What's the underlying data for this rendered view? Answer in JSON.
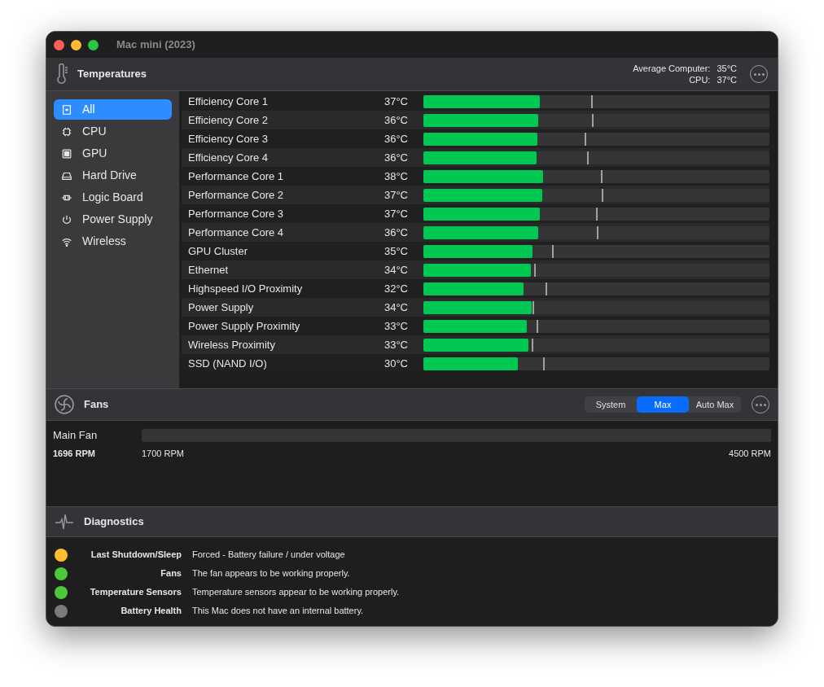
{
  "window": {
    "title": "Mac mini (2023)"
  },
  "temperatures": {
    "title": "Temperatures",
    "summary": [
      {
        "label": "Average Computer:",
        "value": "35°C"
      },
      {
        "label": "CPU:",
        "value": "37°C"
      }
    ]
  },
  "sidebar": {
    "items": [
      {
        "label": "All",
        "kind": "all",
        "selected": true
      },
      {
        "label": "CPU",
        "kind": "cpu",
        "selected": false
      },
      {
        "label": "GPU",
        "kind": "gpu",
        "selected": false
      },
      {
        "label": "Hard Drive",
        "kind": "drive",
        "selected": false
      },
      {
        "label": "Logic Board",
        "kind": "board",
        "selected": false
      },
      {
        "label": "Power Supply",
        "kind": "power",
        "selected": false
      },
      {
        "label": "Wireless",
        "kind": "wireless",
        "selected": false
      }
    ]
  },
  "sensors": [
    {
      "name": "Efficiency Core 1",
      "reading": "37°C",
      "level": 0.336,
      "max": {
        "level": 0.484
      }
    },
    {
      "name": "Efficiency Core 2",
      "reading": "36°C",
      "level": 0.331,
      "max": {
        "level": 0.486
      }
    },
    {
      "name": "Efficiency Core 3",
      "reading": "36°C",
      "level": 0.329,
      "max": {
        "level": 0.465
      }
    },
    {
      "name": "Efficiency Core 4",
      "reading": "36°C",
      "level": 0.326,
      "max": {
        "level": 0.472
      }
    },
    {
      "name": "Performance Core 1",
      "reading": "38°C",
      "level": 0.345,
      "max": {
        "level": 0.512
      }
    },
    {
      "name": "Performance Core 2",
      "reading": "37°C",
      "level": 0.343,
      "max": {
        "level": 0.516
      }
    },
    {
      "name": "Performance Core 3",
      "reading": "37°C",
      "level": 0.336,
      "max": {
        "level": 0.498
      }
    },
    {
      "name": "Performance Core 4",
      "reading": "36°C",
      "level": 0.331,
      "max": {
        "level": 0.5
      }
    },
    {
      "name": "GPU Cluster",
      "reading": "35°C",
      "level": 0.315,
      "max": {
        "level": 0.371
      }
    },
    {
      "name": "Ethernet",
      "reading": "34°C",
      "level": 0.31,
      "max": {
        "level": 0.319
      }
    },
    {
      "name": "Highspeed I/O Proximity",
      "reading": "32°C",
      "level": 0.289,
      "max": {
        "level": 0.352
      }
    },
    {
      "name": "Power Supply",
      "reading": "34°C",
      "level": 0.312,
      "max": {
        "level": 0.315
      }
    },
    {
      "name": "Power Supply Proximity",
      "reading": "33°C",
      "level": 0.298,
      "max": {
        "level": 0.326
      }
    },
    {
      "name": "Wireless Proximity",
      "reading": "33°C",
      "level": 0.303,
      "max": {
        "level": 0.312
      }
    },
    {
      "name": "SSD (NAND I/O)",
      "reading": "30°C",
      "level": 0.272,
      "max": {
        "level": 0.347
      }
    }
  ],
  "fans": {
    "title": "Fans",
    "modes": [
      {
        "label": "System",
        "selected": false
      },
      {
        "label": "Max",
        "selected": true
      },
      {
        "label": "Auto Max",
        "selected": false
      }
    ],
    "items": [
      {
        "name": "Main Fan",
        "current": "1696 RPM",
        "min": "1700 RPM",
        "max": "4500 RPM"
      }
    ]
  },
  "diagnostics": {
    "title": "Diagnostics",
    "items": [
      {
        "label": "Last Shutdown/Sleep",
        "message": "Forced - Battery failure / under voltage",
        "color": "#febc2e"
      },
      {
        "label": "Fans",
        "message": "The fan appears to be working properly.",
        "color": "#4cc93a"
      },
      {
        "label": "Temperature Sensors",
        "message": "Temperature sensors appear to be working properly.",
        "color": "#4cc93a"
      },
      {
        "label": "Battery Health",
        "message": "This Mac does not have an internal battery.",
        "color": "#7a7a7a"
      }
    ]
  }
}
